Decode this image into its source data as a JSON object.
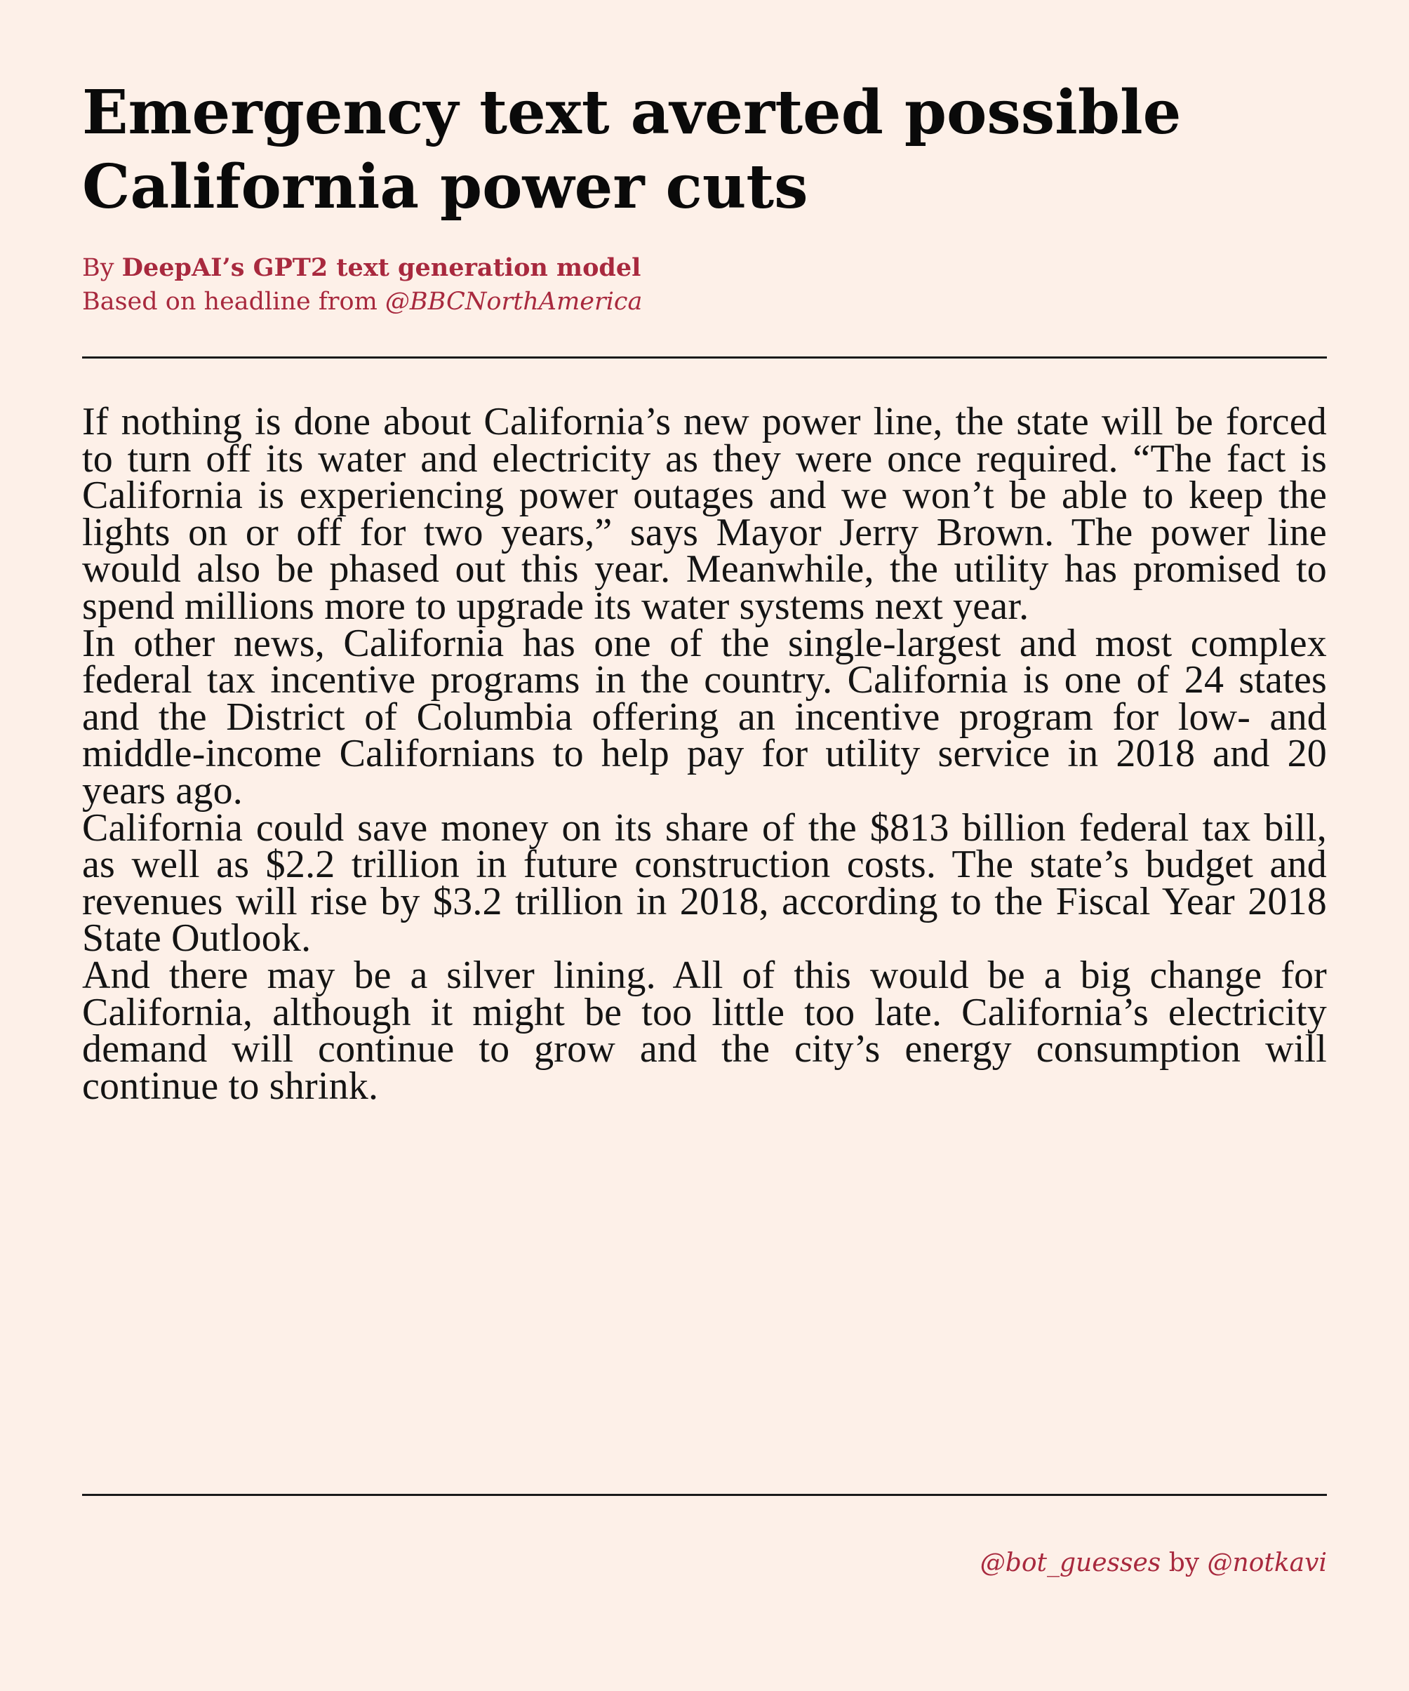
{
  "article": {
    "headline": "Emergency text averted possible California power cuts",
    "byline": {
      "prefix": "By ",
      "author": "DeepAI’s GPT2 text generation model",
      "source_prefix": "Based on headline from ",
      "source_handle": "@BBCNorthAmerica"
    },
    "paragraphs": [
      "If nothing is done about California’s new power line, the state will be forced to turn off its water and electricity as they were once required. “The fact is California is experiencing power outages and we won’t be able to keep the lights on or off for two years,” says Mayor Jerry Brown. The power line would also be phased out this year. Meanwhile, the utility has promised to spend millions more to upgrade its water systems next year.",
      "In other news, California has one of the single-largest and most complex federal tax incentive programs in the country. California is one of 24 states and the District of Columbia offering an incentive program for low- and middle-income Californians to help pay for utility service in 2018 and 20 years ago.",
      "California could save money on its share of the $813 billion federal tax bill, as well as $2.2 trillion in future construction costs. The state’s budget and revenues will rise by $3.2 trillion in 2018, according to the Fiscal Year 2018 State Outlook.",
      "And there may be a silver lining. All of this would be a big change for California, although it might be too little too late. California’s electricity demand will continue to grow and the city’s energy consumption will continue to shrink."
    ]
  },
  "footer": {
    "bot_handle": "@bot_guesses",
    "by_text": " by ",
    "author_handle": "@notkavi"
  },
  "colors": {
    "background": "#fdf0e8",
    "accent": "#a8293e",
    "text": "#141414"
  }
}
